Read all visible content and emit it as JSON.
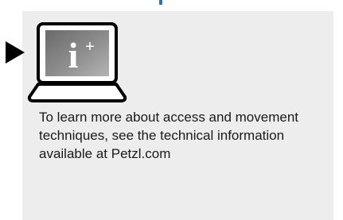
{
  "info_card": {
    "icon_name": "laptop-info-plus-icon",
    "icon_glyph": "i",
    "icon_superscript": "+",
    "text": "To learn more about access and movement techniques, see the technical information available at Petzl.com"
  },
  "colors": {
    "panel_background": "#ededed",
    "screen_dark": "#5a5a5a",
    "screen_light": "#a8a8a8",
    "outline": "#000000"
  }
}
